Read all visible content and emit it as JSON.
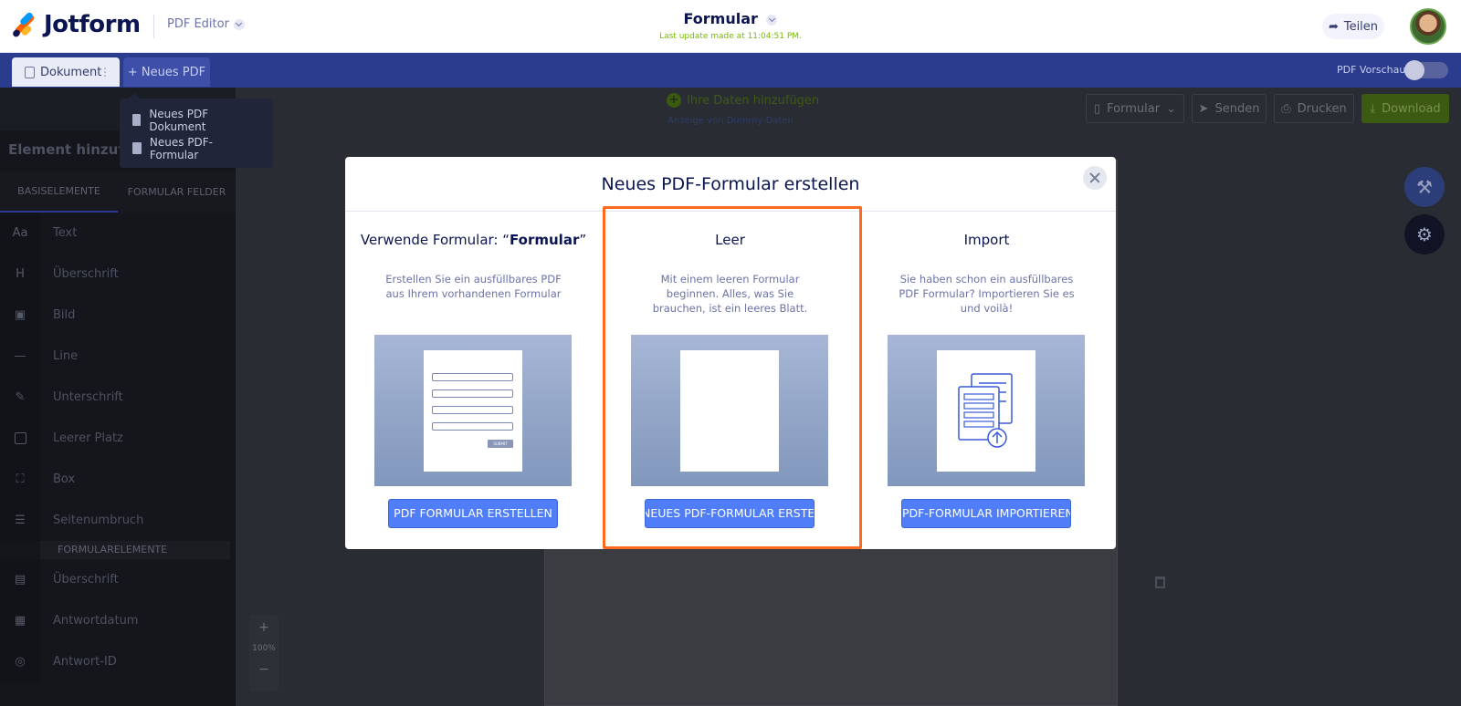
{
  "topbar": {
    "logo_text": "Jotform",
    "editor_switch": "PDF Editor",
    "form_title": "Formular",
    "last_update": "Last update made at 11:04:51 PM.",
    "share_label": "Teilen"
  },
  "tabbar": {
    "doc_tab": "Dokument",
    "new_pdf_tab": "+ Neues PDF",
    "pdf_preview_label": "PDF Vorschau"
  },
  "dropdown": {
    "items": [
      "Neues PDF Dokument",
      "Neues PDF-Formular"
    ]
  },
  "sidebar": {
    "header": "Element hinzufügen",
    "tabs": [
      "BASISELEMENTE",
      "FORMULAR FELDER"
    ],
    "items": [
      {
        "icon": "Aa",
        "label": "Text"
      },
      {
        "icon": "H",
        "label": "Überschrift"
      },
      {
        "icon": "image-icon",
        "label": "Bild"
      },
      {
        "icon": "line-icon",
        "label": "Line"
      },
      {
        "icon": "pen-icon",
        "label": "Unterschrift"
      },
      {
        "icon": "square-icon",
        "label": "Leerer Platz"
      },
      {
        "icon": "box-icon",
        "label": "Box"
      },
      {
        "icon": "page-break-icon",
        "label": "Seitenumbruch"
      }
    ],
    "section_label": "FORMULARELEMENTE",
    "form_items": [
      {
        "icon": "heading-icon",
        "label": "Überschrift"
      },
      {
        "icon": "calendar-icon",
        "label": "Antwortdatum"
      },
      {
        "icon": "fingerprint-icon",
        "label": "Antwort-ID"
      }
    ]
  },
  "canvas": {
    "add_data": "Ihre Daten hinzufügen",
    "dummy_data": "Anzeige von Dummy-Daten",
    "toolbar": {
      "form_select": "Formular",
      "send": "Senden",
      "print": "Drucken",
      "download": "Download"
    },
    "zoom": {
      "plus": "+",
      "level": "100%",
      "minus": "−"
    }
  },
  "modal": {
    "title": "Neues PDF-Formular erstellen",
    "columns": [
      {
        "title_prefix": "Verwende Formular: “",
        "title_bold": "Formular",
        "title_suffix": "”",
        "description": "Erstellen Sie ein ausfüllbares PDF aus Ihrem vorhandenen Formular",
        "button": "PDF FORMULAR ERSTELLEN",
        "submit_text": "SUBMIT"
      },
      {
        "title": "Leer",
        "description": "Mit einem leeren Formular beginnen. Alles, was Sie brauchen, ist ein leeres Blatt.",
        "button": "NEUES PDF-FORMULAR ERSTELLEN"
      },
      {
        "title": "Import",
        "description": "Sie haben schon ein ausfüllbares PDF Formular? Importieren Sie es und voilà!",
        "button": "PDF-FORMULAR IMPORTIEREN"
      }
    ]
  },
  "colors": {
    "accent_blue": "#4f7ef8",
    "tabbar": "#2b3b8e",
    "highlight": "#ff6a1f",
    "download_green": "#78bb07"
  }
}
